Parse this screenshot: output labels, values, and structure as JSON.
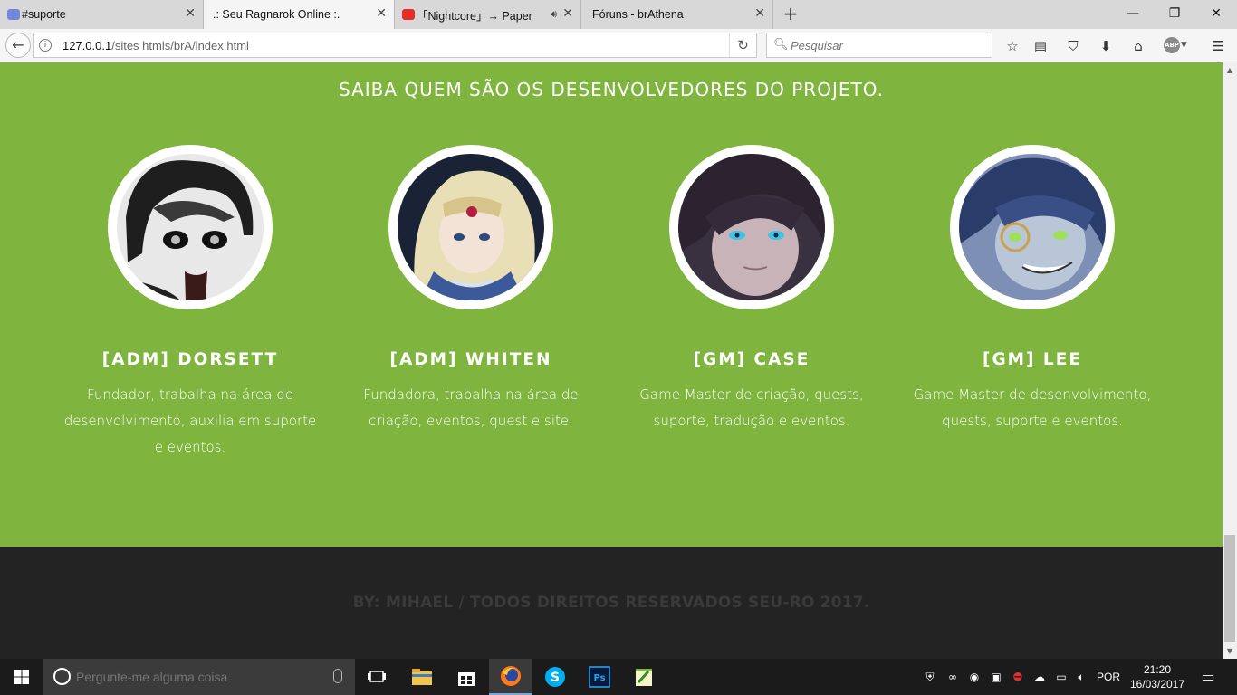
{
  "browser": {
    "tabs": [
      {
        "title": "#suporte",
        "favicon_color": "#7289da",
        "active": false
      },
      {
        "title": ".: Seu Ragnarok Online :.",
        "favicon_color": "#f5f5f5",
        "active": true
      },
      {
        "title": "「Nightcore」→ Paper C…",
        "favicon_color": "#e52d27",
        "active": false,
        "audio": true
      },
      {
        "title": "Fóruns - brAthena",
        "favicon_color": "#d8d8d8",
        "active": false
      }
    ],
    "new_tab_symbol": "+",
    "window_controls": {
      "minimize": "—",
      "maximize": "❐",
      "close": "✕"
    },
    "url": {
      "host": "127.0.0.1",
      "path": "/sites htmls/brA/index.html"
    },
    "search_placeholder": "Pesquisar",
    "abp_label": "ABP"
  },
  "page": {
    "subtitle": "SAIBA QUEM SÃO OS DESENVOLVEDORES DO PROJETO.",
    "members": [
      {
        "name": "[ADM] DORSETT",
        "description": "Fundador, trabalha na área de desenvolvimento, auxilia em suporte e eventos."
      },
      {
        "name": "[ADM] WHITEN",
        "description": "Fundadora, trabalha na área de criação, eventos, quest e site."
      },
      {
        "name": "[GM] CASE",
        "description": "Game Master de criação, quests, suporte, tradução e eventos."
      },
      {
        "name": "[GM] LEE",
        "description": "Game Master de desenvolvimento, quests, suporte e eventos."
      }
    ],
    "footer": "BY: MIHAEL / TODOS DIREITOS RESERVADOS SEU-RO 2017.",
    "colors": {
      "accent_green": "#7fb43f",
      "footer_bg": "#232323",
      "footer_text": "#3a3a3a"
    }
  },
  "taskbar": {
    "search_placeholder": "Pergunte-me alguma coisa",
    "language": "POR",
    "time": "21:20",
    "date": "16/03/2017",
    "apps": [
      "task-view",
      "file-explorer",
      "store",
      "firefox",
      "skype",
      "photoshop",
      "notepad-plus-plus"
    ]
  }
}
